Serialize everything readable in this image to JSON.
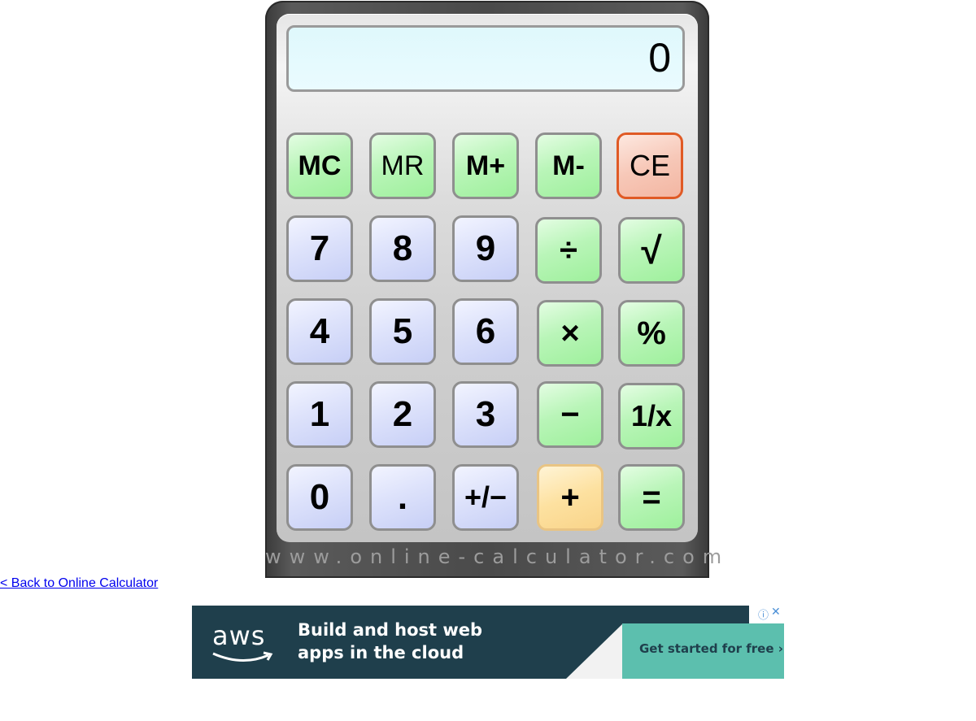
{
  "display": {
    "value": "0"
  },
  "brand_text": "www.online-calculator.com",
  "keys": {
    "mc": "MC",
    "mr": "MR",
    "m_plus": "M+",
    "m_minus": "M-",
    "ce": "CE",
    "seven": "7",
    "eight": "8",
    "nine": "9",
    "divide": "÷",
    "sqrt": "√",
    "four": "4",
    "five": "5",
    "six": "6",
    "multiply": "×",
    "percent": "%",
    "one": "1",
    "two": "2",
    "three": "3",
    "minus": "−",
    "reciprocal": "1/x",
    "zero": "0",
    "decimal": ".",
    "negate": "+/−",
    "plus": "+",
    "equals": "="
  },
  "back_link": "< Back to Online Calculator",
  "ad": {
    "logo": "aws",
    "headline_line1": "Build and host web",
    "headline_line2": "apps in the cloud",
    "cta": "Get started for free ›",
    "info_icon": "ⓘ",
    "close_icon": "✕"
  },
  "colors": {
    "memory_key": "#b9f5b8",
    "number_key": "#dde2fb",
    "clear_key_border": "#e05a25",
    "plus_key": "#fde1a0",
    "ad_background": "#1f3f4c",
    "ad_cta": "#5cbfae"
  }
}
